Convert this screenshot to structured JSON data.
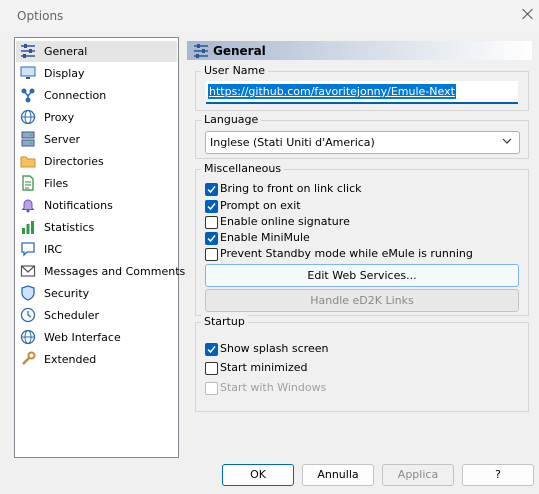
{
  "window": {
    "title": "Options"
  },
  "sidebar": {
    "items": [
      {
        "label": "General",
        "icon": "sliders-icon",
        "selected": true
      },
      {
        "label": "Display",
        "icon": "monitor-icon"
      },
      {
        "label": "Connection",
        "icon": "network-icon"
      },
      {
        "label": "Proxy",
        "icon": "globe-icon"
      },
      {
        "label": "Server",
        "icon": "server-icon"
      },
      {
        "label": "Directories",
        "icon": "folder-icon"
      },
      {
        "label": "Files",
        "icon": "file-icon"
      },
      {
        "label": "Notifications",
        "icon": "bell-icon"
      },
      {
        "label": "Statistics",
        "icon": "bar-chart-icon"
      },
      {
        "label": "IRC",
        "icon": "chat-icon"
      },
      {
        "label": "Messages and Comments",
        "icon": "message-icon"
      },
      {
        "label": "Security",
        "icon": "shield-icon"
      },
      {
        "label": "Scheduler",
        "icon": "clock-icon"
      },
      {
        "label": "Web Interface",
        "icon": "globe-icon"
      },
      {
        "label": "Extended",
        "icon": "wrench-icon"
      }
    ]
  },
  "page": {
    "title": "General"
  },
  "user_name": {
    "label": "User Name",
    "value": "https://github.com/favoritejonny/Emule-Next"
  },
  "language": {
    "label": "Language",
    "selected": "Inglese (Stati Uniti d'America)"
  },
  "misc": {
    "label": "Miscellaneous",
    "bring_front": {
      "label": "Bring to front on link click",
      "checked": true
    },
    "prompt_exit": {
      "label": "Prompt on exit",
      "checked": true
    },
    "online_sig": {
      "label": "Enable online signature",
      "checked": false
    },
    "minimule": {
      "label": "Enable MiniMule",
      "checked": true
    },
    "standby": {
      "label": "Prevent Standby mode while eMule is running",
      "checked": false
    },
    "edit_web_services": "Edit Web Services...",
    "handle_ed2k": "Handle eD2K Links"
  },
  "startup": {
    "label": "Startup",
    "splash": {
      "label": "Show splash screen",
      "checked": true
    },
    "minimized": {
      "label": "Start minimized",
      "checked": false
    },
    "windows": {
      "label": "Start with Windows",
      "checked": false,
      "disabled": true
    }
  },
  "buttons": {
    "ok": "OK",
    "cancel": "Annulla",
    "apply": "Applica",
    "help": "?"
  },
  "colors": {
    "accent": "#005fb8",
    "header_gradient_start": "#a7b8d0",
    "selection": "#0078d7"
  }
}
